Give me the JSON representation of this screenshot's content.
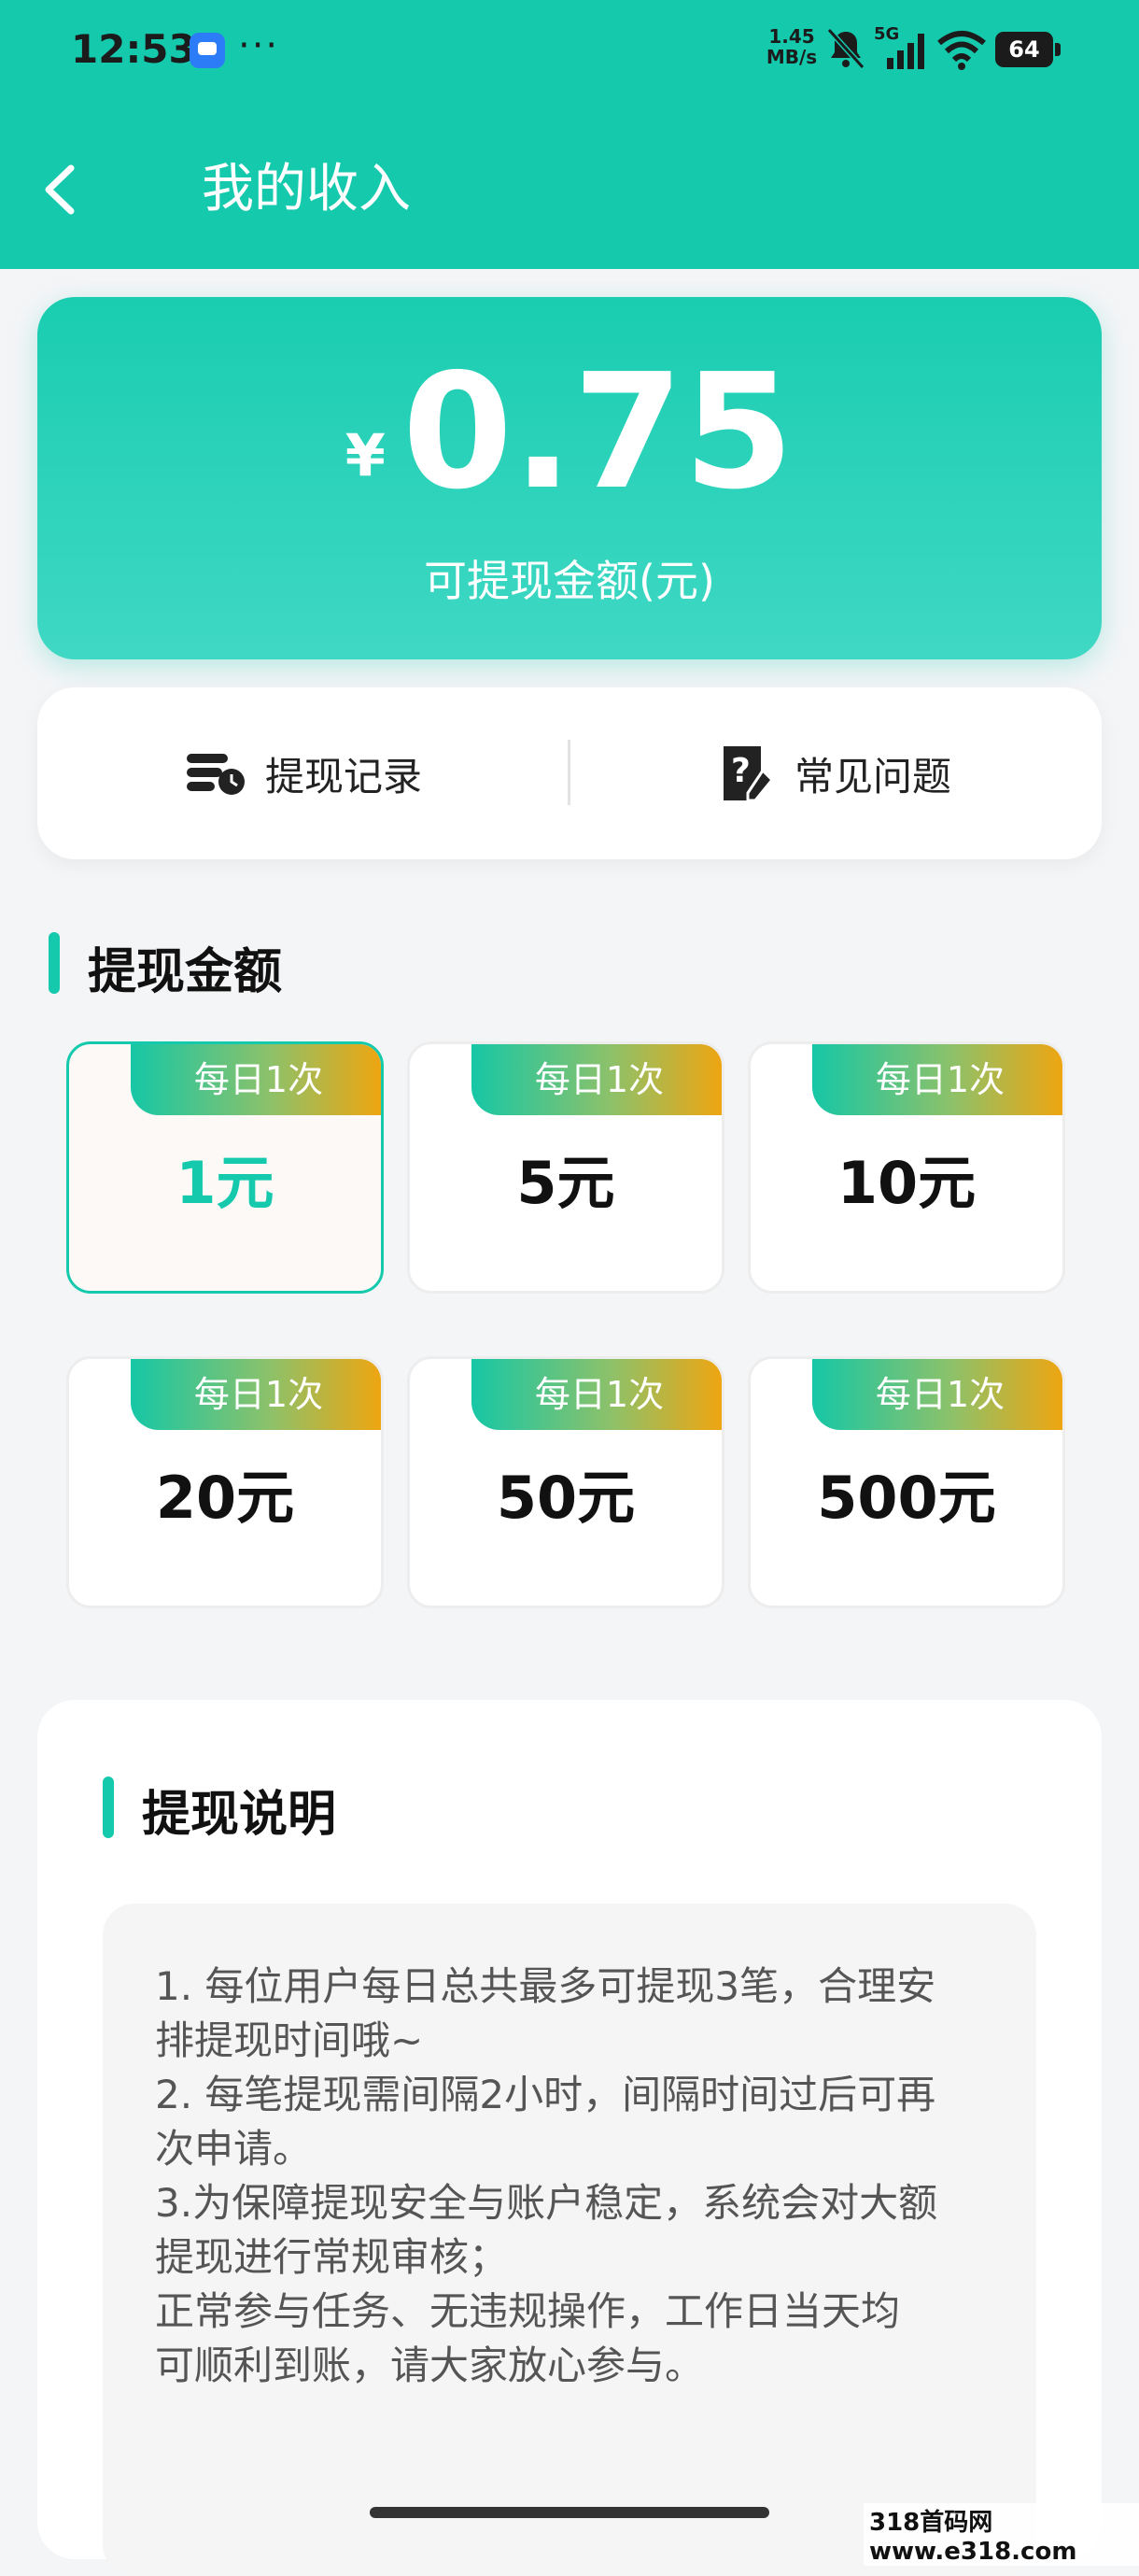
{
  "status_bar": {
    "time": "12:53",
    "net_speed_value": "1.45",
    "net_speed_unit": "MB/s",
    "network_type": "5G",
    "battery": "64",
    "more": "···"
  },
  "header": {
    "title": "我的收入"
  },
  "balance": {
    "currency": "¥",
    "amount": "0.75",
    "label": "可提现金额(元)"
  },
  "actions": {
    "records": "提现记录",
    "faq": "常见问题"
  },
  "withdraw": {
    "title": "提现金额",
    "selected_index": 0,
    "options": [
      {
        "tag": "每日1次",
        "amount": "1元"
      },
      {
        "tag": "每日1次",
        "amount": "5元"
      },
      {
        "tag": "每日1次",
        "amount": "10元"
      },
      {
        "tag": "每日1次",
        "amount": "20元"
      },
      {
        "tag": "每日1次",
        "amount": "50元"
      },
      {
        "tag": "每日1次",
        "amount": "500元"
      }
    ]
  },
  "notes": {
    "title": "提现说明",
    "lines": [
      "1. 每位用户每日总共最多可提现3笔，合理安",
      "排提现时间哦~",
      "2. 每笔提现需间隔2小时，间隔时间过后可再",
      "次申请。",
      "3.为保障提现安全与账户稳定，系统会对大额",
      "提现进行常规审核；",
      "正常参与任务、无违规操作，工作日当天均",
      "可顺利到账，请大家放心参与。"
    ]
  },
  "watermark": "318首码网 www.e318.com",
  "colors": {
    "accent": "#15c9ad",
    "tag_end": "#f3a40d"
  }
}
